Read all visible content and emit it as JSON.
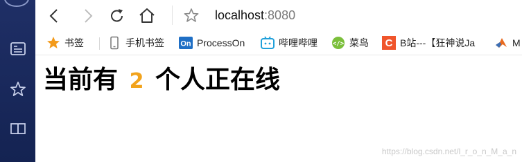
{
  "toolbar": {
    "url_host": "localhost",
    "url_port": ":8080"
  },
  "bookmarks": [
    {
      "label": "书签",
      "icon": "star-icon"
    },
    {
      "label": "手机书签",
      "icon": "phone-icon"
    },
    {
      "label": "ProcessOn",
      "icon": "processon-icon"
    },
    {
      "label": "哔哩哔哩",
      "icon": "bilibili-icon"
    },
    {
      "label": "菜鸟",
      "icon": "runoob-icon"
    },
    {
      "label": "B站---【狂神说Ja",
      "icon": "c-icon"
    },
    {
      "label": "M",
      "icon": "matlab-icon"
    }
  ],
  "content": {
    "prefix": "当前有",
    "count": "2",
    "suffix": "个人正在线"
  },
  "watermark": "https://blog.csdn.net/l_r_o_n_M_a_n",
  "colors": {
    "sidebar": "#1f2f66",
    "count_accent": "#f2a31c"
  }
}
